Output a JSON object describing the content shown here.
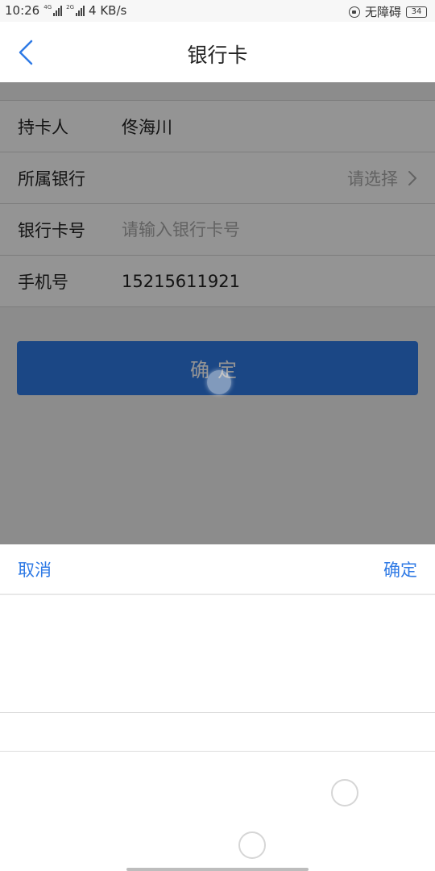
{
  "status_bar": {
    "time": "10:26",
    "net1": "4G",
    "net2": "2G",
    "speed": "4 KB/s",
    "accessibility": "无障碍",
    "battery": "34"
  },
  "nav": {
    "title": "银行卡",
    "back_icon": "chevron-left-icon"
  },
  "form": {
    "holder_label": "持卡人",
    "holder_value": "佟海川",
    "bank_label": "所属银行",
    "bank_select": "请选择",
    "card_label": "银行卡号",
    "card_placeholder": "请输入银行卡号",
    "phone_label": "手机号",
    "phone_value": "15215611921",
    "submit_label": "确定"
  },
  "picker": {
    "cancel_label": "取消",
    "confirm_label": "确定"
  },
  "colors": {
    "accent": "#2f7ae5",
    "overlay": "rgba(0,0,0,0.42)"
  }
}
